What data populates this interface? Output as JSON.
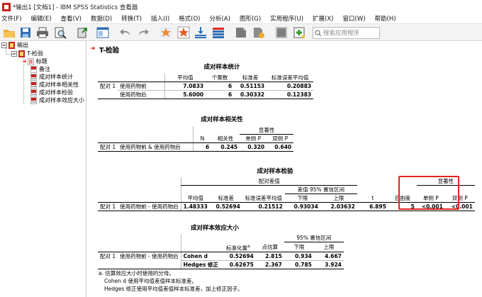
{
  "window": {
    "title": "*输出1 [文档1] - IBM SPSS Statistics 查看器"
  },
  "menu": [
    "文件(F)",
    "编辑(E)",
    "查看(V)",
    "数据(D)",
    "转换(T)",
    "插入(I)",
    "格式(O)",
    "分析(A)",
    "图形(G)",
    "实用程序(U)",
    "扩展(X)",
    "窗口(W)",
    "帮助(H)"
  ],
  "toolbar": {
    "icons": [
      "open-icon",
      "save-icon",
      "print-icon",
      "print-preview-icon",
      "export-icon",
      "recall-dialog-icon",
      "undo-icon",
      "redo-icon",
      "goto-data-icon",
      "goto-case-icon",
      "goto-variable-icon",
      "variables-icon",
      "designate-window-icon",
      "create-script-icon",
      "show-all-icon",
      "hide-icon",
      "insert-output-icon"
    ],
    "search_placeholder": "搜索应用程序"
  },
  "tree": {
    "root": "输出",
    "section": "T-检验",
    "items": [
      "标题",
      "备注",
      "成对样本统计",
      "成对样本相关性",
      "成对样本检验",
      "成对样本效应大小"
    ]
  },
  "output": {
    "section_title": "T-检验",
    "paired_stats": {
      "title": "成对样本统计",
      "headers": [
        "平均值",
        "个案数",
        "标准差",
        "标准误差平均值"
      ],
      "pair_label": "配对 1",
      "rows": [
        {
          "label": "使用药物前",
          "mean": "7.0833",
          "n": "6",
          "sd": "0.51153",
          "se": "0.20883"
        },
        {
          "label": "使用药物后",
          "mean": "5.6000",
          "n": "6",
          "sd": "0.30332",
          "se": "0.12383"
        }
      ]
    },
    "paired_corr": {
      "title": "成对样本相关性",
      "sig_header": "显著性",
      "headers": [
        "N",
        "相关性",
        "单侧 P",
        "双侧 P"
      ],
      "pair_label": "配对 1",
      "row_label": "使用药物前 & 使用药物后",
      "values": [
        "6",
        "0.245",
        "0.320",
        "0.640"
      ]
    },
    "paired_test": {
      "title": "成对样本检验",
      "diff_header": "配对差值",
      "ci_header": "差值 95% 置信区间",
      "sig_header": "显著性",
      "headers": [
        "平均值",
        "标准差",
        "标准误差平均值",
        "下限",
        "上限",
        "t",
        "自由度",
        "单侧 P",
        "双侧 P"
      ],
      "pair_label": "配对 1",
      "row_label": "使用药物前 - 使用药物后",
      "values": [
        "1.48333",
        "0.52694",
        "0.21512",
        "0.93034",
        "2.03632",
        "6.895",
        "5",
        "<0.001",
        "<0.001"
      ]
    },
    "effect_size": {
      "title": "成对样本效应大小",
      "ci_header": "95% 置信区间",
      "headers": [
        "标准化量",
        "点估算",
        "下限",
        "上限"
      ],
      "superscript": "a",
      "pair_label": "配对 1",
      "row_label": "使用药物前 - 使用药物后",
      "rows": [
        {
          "label": "Cohen d",
          "std": "0.52694",
          "est": "2.815",
          "lo": "0.934",
          "hi": "4.667"
        },
        {
          "label": "Hedges 修正",
          "std": "0.62675",
          "est": "2.367",
          "lo": "0.785",
          "hi": "3.924"
        }
      ],
      "footnotes": [
        "a. 估算效应大小时使用的分母。",
        "Cohen d 使用平均值差值样本标准差。",
        "Hedges 修正使用平均值差值样本标准差，加上修正因子。"
      ]
    }
  },
  "colors": {
    "highlight": "#e0261b",
    "accent_red": "#c0281e"
  }
}
